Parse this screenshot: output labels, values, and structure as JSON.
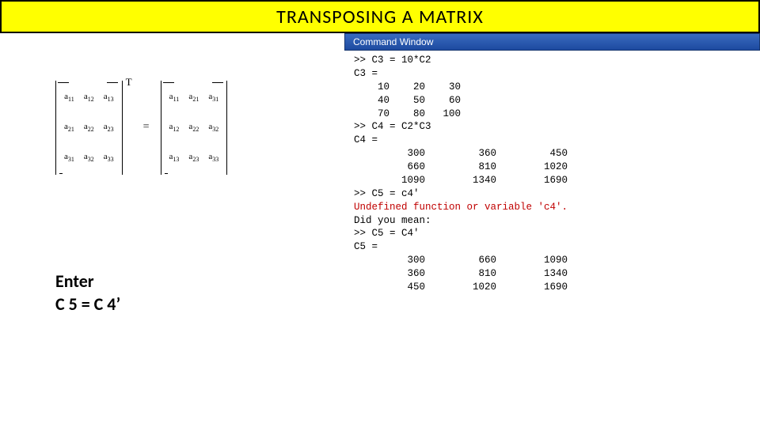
{
  "title": "TRANSPOSING A MATRIX",
  "equation": {
    "left_matrix": [
      [
        "a11",
        "a12",
        "a13"
      ],
      [
        "a21",
        "a22",
        "a23"
      ],
      [
        "a31",
        "a32",
        "a33"
      ]
    ],
    "superscript": "T",
    "equals": "=",
    "right_matrix": [
      [
        "a11",
        "a21",
        "a31"
      ],
      [
        "a12",
        "a22",
        "a32"
      ],
      [
        "a13",
        "a23",
        "a33"
      ]
    ]
  },
  "instruction": {
    "line1": "Enter",
    "line2": "C 5 = C 4’"
  },
  "command_window": {
    "title": "Command Window",
    "lines": [
      {
        "t": ">> C3 = 10*C2",
        "cls": ""
      },
      {
        "t": "",
        "cls": ""
      },
      {
        "t": "C3 =",
        "cls": ""
      },
      {
        "t": "",
        "cls": ""
      },
      {
        "t": "    10    20    30",
        "cls": ""
      },
      {
        "t": "    40    50    60",
        "cls": ""
      },
      {
        "t": "    70    80   100",
        "cls": ""
      },
      {
        "t": "",
        "cls": ""
      },
      {
        "t": ">> C4 = C2*C3",
        "cls": ""
      },
      {
        "t": "",
        "cls": ""
      },
      {
        "t": "C4 =",
        "cls": ""
      },
      {
        "t": "",
        "cls": ""
      },
      {
        "t": "         300         360         450",
        "cls": ""
      },
      {
        "t": "         660         810        1020",
        "cls": ""
      },
      {
        "t": "        1090        1340        1690",
        "cls": ""
      },
      {
        "t": "",
        "cls": ""
      },
      {
        "t": ">> C5 = c4'",
        "cls": ""
      },
      {
        "t": "Undefined function or variable 'c4'.",
        "cls": "err"
      },
      {
        "t": "",
        "cls": ""
      },
      {
        "t": "Did you mean:",
        "cls": ""
      },
      {
        "t": ">> C5 = C4'",
        "cls": ""
      },
      {
        "t": "",
        "cls": ""
      },
      {
        "t": "C5 =",
        "cls": ""
      },
      {
        "t": "",
        "cls": ""
      },
      {
        "t": "         300         660        1090",
        "cls": ""
      },
      {
        "t": "         360         810        1340",
        "cls": ""
      },
      {
        "t": "         450        1020        1690",
        "cls": ""
      }
    ]
  },
  "chart_data": {
    "type": "table",
    "title": "Matrix transpose example (MATLAB)",
    "tables": [
      {
        "name": "C3",
        "rows": [
          [
            10,
            20,
            30
          ],
          [
            40,
            50,
            60
          ],
          [
            70,
            80,
            100
          ]
        ]
      },
      {
        "name": "C4",
        "rows": [
          [
            300,
            360,
            450
          ],
          [
            660,
            810,
            1020
          ],
          [
            1090,
            1340,
            1690
          ]
        ]
      },
      {
        "name": "C5",
        "rows": [
          [
            300,
            660,
            1090
          ],
          [
            360,
            810,
            1340
          ],
          [
            450,
            1020,
            1690
          ]
        ]
      }
    ]
  }
}
